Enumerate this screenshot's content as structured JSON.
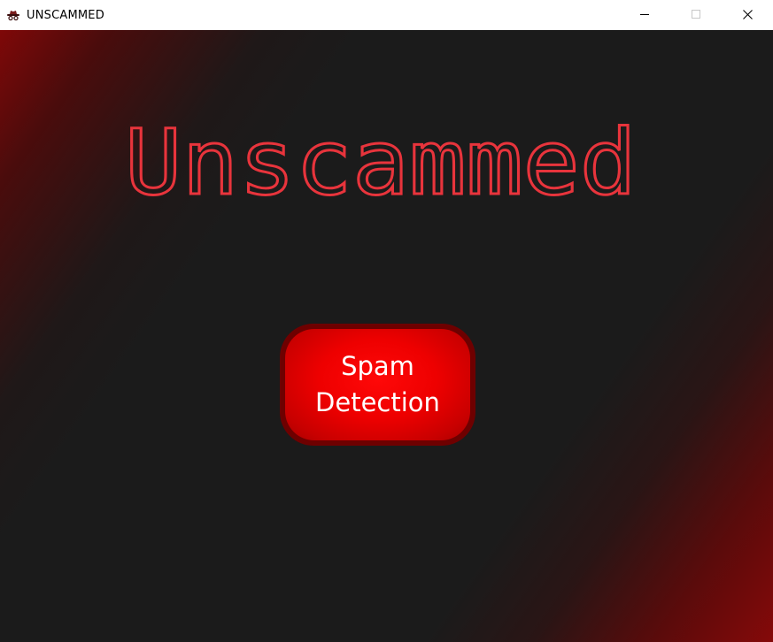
{
  "window": {
    "title": "UNSCAMMED",
    "icon": "spy-hat-icon",
    "controls": [
      "minimize-icon",
      "maximize-icon",
      "close-icon"
    ]
  },
  "main": {
    "app_title": "Unscammed",
    "spam_button": {
      "line1": "Spam",
      "line2": "Detection"
    }
  },
  "colors": {
    "background": "#1b1b1b",
    "accent_red": "#ff0000",
    "title_outline": "#e8343c",
    "button_border": "#6e0000",
    "corner_glow": "#7f0808"
  }
}
